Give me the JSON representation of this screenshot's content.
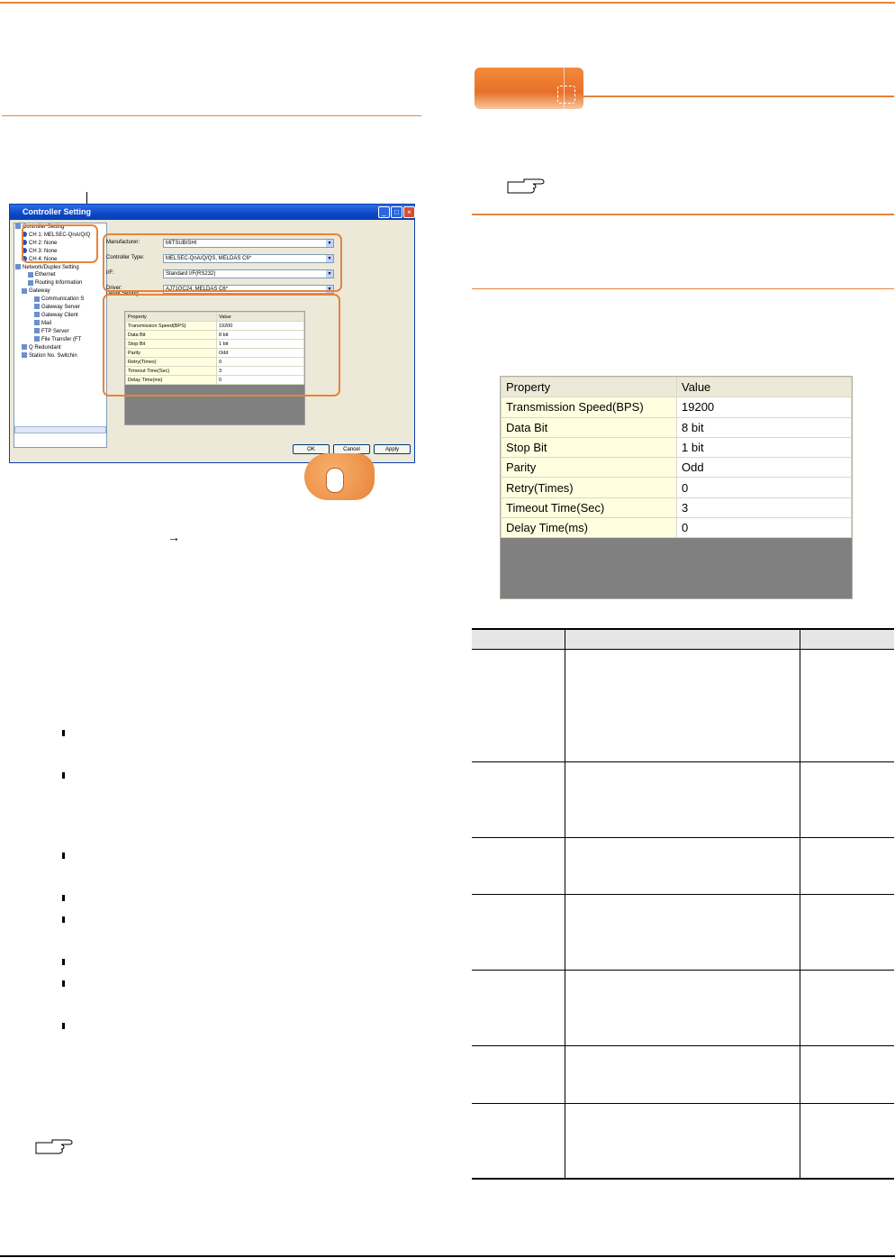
{
  "dialog": {
    "title": "Controller Setting",
    "tree": [
      {
        "label": "Controller Setting",
        "indent": 0,
        "kind": "folder"
      },
      {
        "label": "CH 1: MELSEC-QnA/Q/Q",
        "indent": 1,
        "kind": "ch"
      },
      {
        "label": "CH 2: None",
        "indent": 1,
        "kind": "ch"
      },
      {
        "label": "CH 3: None",
        "indent": 1,
        "kind": "ch"
      },
      {
        "label": "CH 4: None",
        "indent": 1,
        "kind": "ch"
      },
      {
        "label": "Network/Duplex Setting",
        "indent": 0,
        "kind": "folder"
      },
      {
        "label": "Ethernet",
        "indent": 2,
        "kind": "item"
      },
      {
        "label": "Routing Information",
        "indent": 2,
        "kind": "item"
      },
      {
        "label": "Gateway",
        "indent": 1,
        "kind": "folder"
      },
      {
        "label": "Communication S",
        "indent": 3,
        "kind": "item"
      },
      {
        "label": "Gateway Server",
        "indent": 3,
        "kind": "item"
      },
      {
        "label": "Gateway Client",
        "indent": 3,
        "kind": "item"
      },
      {
        "label": "Mail",
        "indent": 3,
        "kind": "item"
      },
      {
        "label": "FTP Server",
        "indent": 3,
        "kind": "item"
      },
      {
        "label": "File Transfer (FT",
        "indent": 3,
        "kind": "item"
      },
      {
        "label": "Q Redundant",
        "indent": 1,
        "kind": "item"
      },
      {
        "label": "Station No. Switchin",
        "indent": 1,
        "kind": "item"
      }
    ],
    "fields": [
      {
        "label": "Manufacturer:",
        "value": "MITSUBISHI"
      },
      {
        "label": "Controller Type:",
        "value": "MELSEC-QnA/Q/QS, MELDAS C6*"
      },
      {
        "label": "I/F:",
        "value": "Standard I/F(RS232)"
      },
      {
        "label": "Driver:",
        "value": "AJ71QC24, MELDAS C6*"
      }
    ],
    "detail_label": "Detail Setting",
    "grid_headers": [
      "Property",
      "Value"
    ],
    "grid_rows": [
      [
        "Transmission Speed(BPS)",
        "19200"
      ],
      [
        "Data Bit",
        "8 bit"
      ],
      [
        "Stop Bit",
        "1 bit"
      ],
      [
        "Parity",
        "Odd"
      ],
      [
        "Retry(Times)",
        "0"
      ],
      [
        "Timeout Time(Sec)",
        "3"
      ],
      [
        "Delay Time(ms)",
        "0"
      ]
    ],
    "buttons": {
      "ok": "OK",
      "cancel": "Cancel",
      "apply": "Apply"
    }
  },
  "arrow_glyph": "→",
  "property_table": {
    "headers": [
      "Property",
      "Value"
    ],
    "rows": [
      [
        "Transmission Speed(BPS)",
        "19200"
      ],
      [
        "Data Bit",
        "8 bit"
      ],
      [
        "Stop Bit",
        "1 bit"
      ],
      [
        "Parity",
        "Odd"
      ],
      [
        "Retry(Times)",
        "0"
      ],
      [
        "Timeout Time(Sec)",
        "3"
      ],
      [
        "Delay Time(ms)",
        "0"
      ]
    ]
  },
  "colors": {
    "accent": "#e8833a",
    "titlebar": "#0a48c8",
    "window": "#ece9d8"
  }
}
